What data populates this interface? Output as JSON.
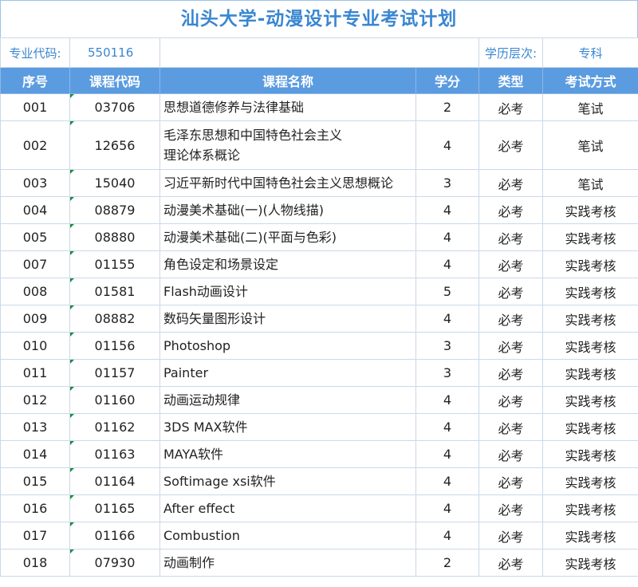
{
  "title": "汕头大学-动漫设计专业考试计划",
  "meta": {
    "code_label": "专业代码:",
    "code_value": "550116",
    "level_label": "学历层次:",
    "level_value": "专科"
  },
  "headers": [
    "序号",
    "课程代码",
    "课程名称",
    "学分",
    "类型",
    "考试方式"
  ],
  "rows": [
    {
      "no": "001",
      "code": "03706",
      "name": "思想道德修养与法律基础",
      "credit": "2",
      "type": "必考",
      "exam": "笔试"
    },
    {
      "no": "002",
      "code": "12656",
      "name": "毛泽东思想和中国特色社会主义\n理论体系概论",
      "credit": "4",
      "type": "必考",
      "exam": "笔试"
    },
    {
      "no": "003",
      "code": "15040",
      "name": "习近平新时代中国特色社会主义思想概论",
      "credit": "3",
      "type": "必考",
      "exam": "笔试"
    },
    {
      "no": "004",
      "code": "08879",
      "name": "动漫美术基础(一)(人物线描)",
      "credit": "4",
      "type": "必考",
      "exam": "实践考核"
    },
    {
      "no": "005",
      "code": "08880",
      "name": "动漫美术基础(二)(平面与色彩)",
      "credit": "4",
      "type": "必考",
      "exam": "实践考核"
    },
    {
      "no": "007",
      "code": "01155",
      "name": "角色设定和场景设定",
      "credit": "4",
      "type": "必考",
      "exam": "实践考核"
    },
    {
      "no": "008",
      "code": "01581",
      "name": "Flash动画设计",
      "credit": "5",
      "type": "必考",
      "exam": "实践考核"
    },
    {
      "no": "009",
      "code": "08882",
      "name": "数码矢量图形设计",
      "credit": "4",
      "type": "必考",
      "exam": "实践考核"
    },
    {
      "no": "010",
      "code": "01156",
      "name": "Photoshop",
      "credit": "3",
      "type": "必考",
      "exam": "实践考核"
    },
    {
      "no": "011",
      "code": "01157",
      "name": "Painter",
      "credit": "3",
      "type": "必考",
      "exam": "实践考核"
    },
    {
      "no": "012",
      "code": "01160",
      "name": "动画运动规律",
      "credit": "4",
      "type": "必考",
      "exam": "实践考核"
    },
    {
      "no": "013",
      "code": "01162",
      "name": "3DS MAX软件",
      "credit": "4",
      "type": "必考",
      "exam": "实践考核"
    },
    {
      "no": "014",
      "code": "01163",
      "name": "MAYA软件",
      "credit": "4",
      "type": "必考",
      "exam": "实践考核"
    },
    {
      "no": "015",
      "code": "01164",
      "name": "Softimage xsi软件",
      "credit": "4",
      "type": "必考",
      "exam": "实践考核"
    },
    {
      "no": "016",
      "code": "01165",
      "name": "After effect",
      "credit": "4",
      "type": "必考",
      "exam": "实践考核"
    },
    {
      "no": "017",
      "code": "01166",
      "name": "Combustion",
      "credit": "4",
      "type": "必考",
      "exam": "实践考核"
    },
    {
      "no": "018",
      "code": "07930",
      "name": "动画制作",
      "credit": "2",
      "type": "必考",
      "exam": "实践考核"
    }
  ],
  "colors": {
    "title": "#3a86d1",
    "header_bg": "#5b9be0",
    "grid": "#c9d9ea",
    "corner_mark": "#1a8f3c"
  }
}
